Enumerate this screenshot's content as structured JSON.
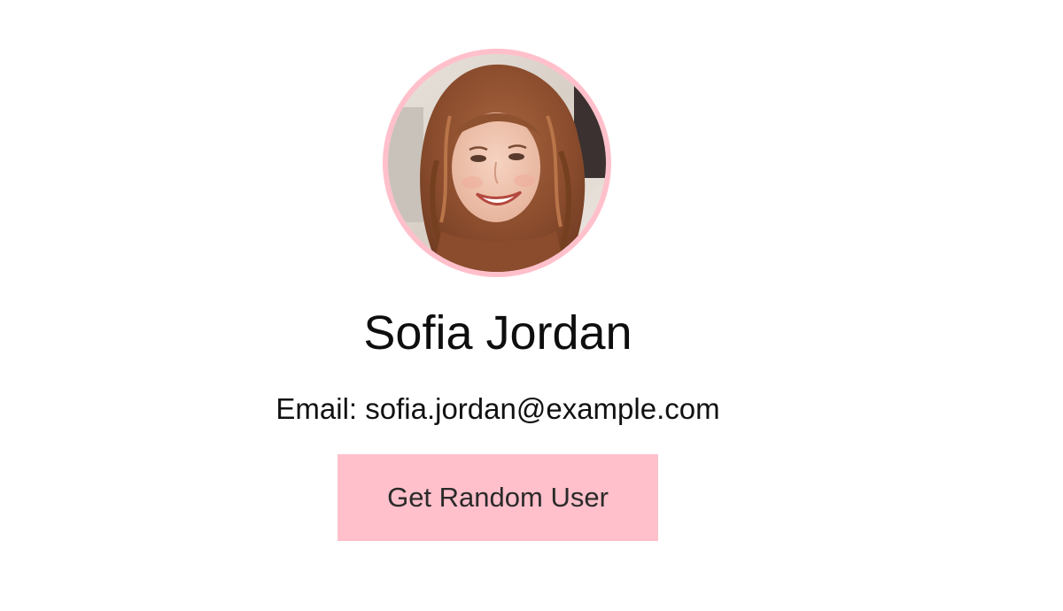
{
  "profile": {
    "name": "Sofia Jordan",
    "email_label": "Email: sofia.jordan@example.com",
    "button_label": "Get Random User"
  },
  "theme": {
    "accent": "#ffc0cb",
    "text": "#111111",
    "background": "#ffffff"
  },
  "icons": {
    "avatar": "user-photo"
  }
}
